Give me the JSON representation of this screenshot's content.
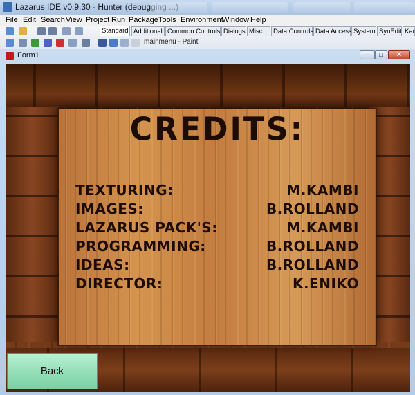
{
  "ide": {
    "title": "Lazarus IDE v0.9.30 - Hunter (debugging ...)",
    "menu": [
      "File",
      "Edit",
      "Search",
      "View",
      "Project",
      "Run",
      "Package",
      "Tools",
      "Environment",
      "Window",
      "Help"
    ],
    "palette_tabs": [
      "Standard",
      "Additional",
      "Common Controls",
      "Dialogs",
      "Misc",
      "Data Controls",
      "Data Access",
      "System",
      "SynEdit",
      "Kam"
    ],
    "active_palette_tab": "Standard",
    "taskbar_label": "mainmenu - Paint"
  },
  "form": {
    "title": "Form1",
    "window_buttons": [
      "minimize",
      "maximize",
      "close"
    ]
  },
  "credits": {
    "heading": "CREDITS:",
    "rows": [
      {
        "label": "TEXTURING:",
        "value": "M.KAMBI"
      },
      {
        "label": "IMAGES:",
        "value": "B.ROLLAND"
      },
      {
        "label": "LAZARUS PACK'S:",
        "value": "M.KAMBI"
      },
      {
        "label": "PROGRAMMING:",
        "value": "B.ROLLAND"
      },
      {
        "label": "IDEAS:",
        "value": "B.ROLLAND"
      },
      {
        "label": "DIRECTOR:",
        "value": "K.ENIKO"
      }
    ]
  },
  "back_button": {
    "label": "Back"
  }
}
